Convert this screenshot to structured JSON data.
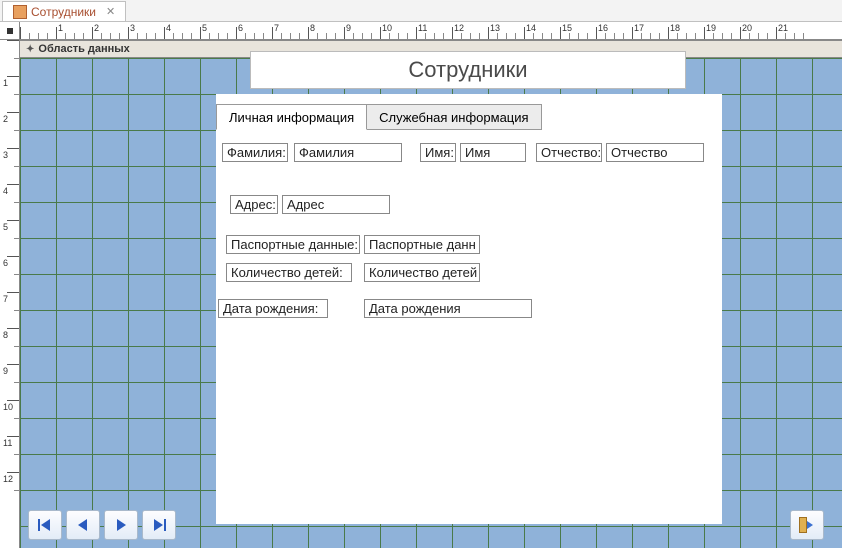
{
  "window": {
    "tab_title": "Сотрудники"
  },
  "section": {
    "data_area": "Область данных"
  },
  "form": {
    "title": "Сотрудники",
    "tabs": [
      {
        "label": "Личная информация",
        "active": true
      },
      {
        "label": "Служебная информация",
        "active": false
      }
    ],
    "fields": {
      "surname": {
        "label": "Фамилия:",
        "value": "Фамилия"
      },
      "name": {
        "label": "Имя:",
        "value": "Имя"
      },
      "patronymic": {
        "label": "Отчество:",
        "value": "Отчество"
      },
      "address": {
        "label": "Адрес:",
        "value": "Адрес"
      },
      "passport": {
        "label": "Паспортные данные:",
        "value": "Паспортные данн"
      },
      "children": {
        "label": "Количество детей:",
        "value": "Количество детей"
      },
      "birthdate": {
        "label": "Дата рождения:",
        "value": "Дата рождения"
      }
    }
  },
  "ruler": {
    "h_numbers": [
      "",
      "1",
      "2",
      "3",
      "4",
      "5",
      "6",
      "7",
      "8",
      "9",
      "10",
      "11",
      "12",
      "13",
      "14",
      "15",
      "16",
      "17",
      "18",
      "19",
      "20",
      "21"
    ],
    "v_numbers": [
      "",
      "1",
      "2",
      "3",
      "4",
      "5",
      "6",
      "7",
      "8",
      "9",
      "10",
      "11",
      "12"
    ]
  },
  "nav": {
    "first": "|◀",
    "prev": "◀",
    "next": "▶",
    "last": "▶|"
  }
}
